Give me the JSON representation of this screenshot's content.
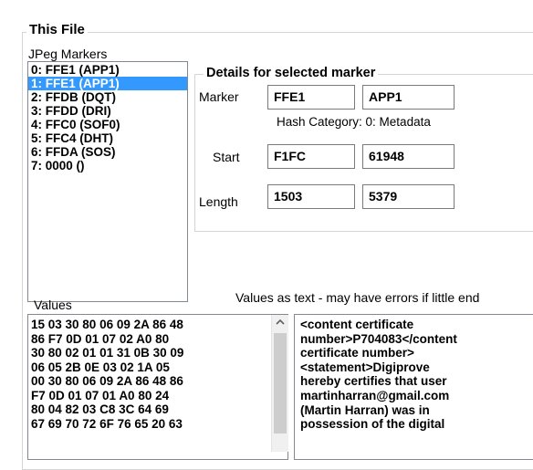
{
  "section": {
    "title": "This File"
  },
  "markers": {
    "label": "JPeg Markers",
    "items": [
      "0: FFE1  (APP1)",
      "1: FFE1  (APP1)",
      "2: FFDB  (DQT)",
      "3: FFDD  (DRI)",
      "4: FFC0  (SOF0)",
      "5: FFC4  (DHT)",
      "6: FFDA  (SOS)",
      "7: 0000  ()"
    ],
    "selected_index": 1
  },
  "details": {
    "title": "Details for selected marker",
    "marker_label": "Marker",
    "marker_code": "FFE1",
    "marker_name": "APP1",
    "hash_category": "Hash Category: 0: Metadata",
    "start_label": "Start",
    "start_hex": "F1FC",
    "start_dec": "61948",
    "length_label": "Length",
    "length_dec": "1503",
    "length_hex": "5379"
  },
  "values": {
    "label": "Values",
    "hex_lines": [
      "15 03 30 80 06 09 2A 86 48",
      "86 F7 0D 01 07 02 A0 80",
      "30 80 02 01 01 31 0B 30 09",
      "06 05 2B 0E 03 02 1A 05",
      "00 30 80 06 09 2A 86 48 86",
      "F7 0D 01 07 01 A0 80 24",
      "80 04 82 03 C8 3C 64 69",
      "67 69 70 72 6F 76 65 20 63"
    ]
  },
  "text_values": {
    "label": "Values as text - may have errors if little end",
    "lines": [
      "<content certificate",
      "number>P704083</content",
      "certificate number>",
      "<statement>Digiprove",
      "hereby certifies that user",
      "martinharran@gmail.com",
      "(Martin Harran) was in",
      "possession of the digital"
    ]
  },
  "icons": {
    "scroll_up": "chevron-up-icon"
  }
}
